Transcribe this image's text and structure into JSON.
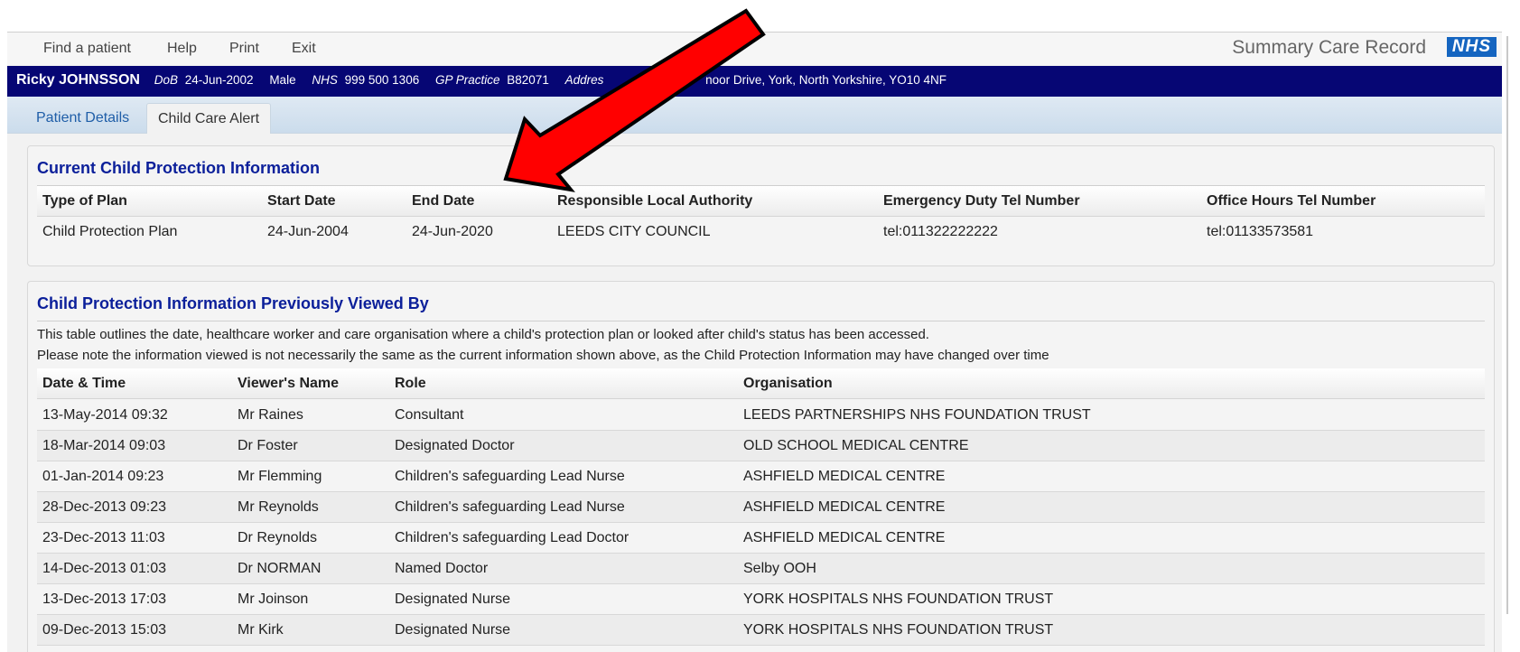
{
  "menu": {
    "items": [
      {
        "label": "Find a patient"
      },
      {
        "label": "Help"
      },
      {
        "label": "Print"
      },
      {
        "label": "Exit"
      }
    ],
    "brand": "Summary Care Record",
    "logo": "NHS"
  },
  "patient": {
    "name": "Ricky JOHNSSON",
    "dob_label": "DoB",
    "dob": "24-Jun-2002",
    "gender": "Male",
    "nhs_label": "NHS",
    "nhs": "999 500 1306",
    "gp_label": "GP Practice",
    "gp": "B82071",
    "address_label": "Addres",
    "address": "noor Drive, York, North Yorkshire, YO10 4NF"
  },
  "tabs": [
    {
      "label": "Patient Details",
      "active": false
    },
    {
      "label": "Child Care Alert",
      "active": true
    }
  ],
  "current": {
    "title": "Current Child Protection Information",
    "headers": [
      "Type of Plan",
      "Start Date",
      "End Date",
      "Responsible Local Authority",
      "Emergency Duty Tel Number",
      "Office Hours Tel Number"
    ],
    "row": [
      "Child Protection Plan",
      "24-Jun-2004",
      "24-Jun-2020",
      "LEEDS CITY COUNCIL",
      "tel:011322222222",
      "tel:01133573581"
    ]
  },
  "viewed": {
    "title": "Child Protection Information Previously Viewed By",
    "desc1": "This table outlines the date, healthcare worker and care organisation where a child's protection plan or looked after child's status has been accessed.",
    "desc2": "Please note the information viewed is not necessarily the same as the current information shown above, as the Child Protection Information may have changed over time",
    "headers": [
      "Date & Time",
      "Viewer's Name",
      "Role",
      "Organisation"
    ],
    "rows": [
      [
        "13-May-2014 09:32",
        "Mr Raines",
        "Consultant",
        "LEEDS PARTNERSHIPS NHS FOUNDATION TRUST"
      ],
      [
        "18-Mar-2014 09:03",
        "Dr Foster",
        "Designated Doctor",
        "OLD SCHOOL MEDICAL CENTRE"
      ],
      [
        "01-Jan-2014 09:23",
        "Mr Flemming",
        "Children's safeguarding Lead Nurse",
        "ASHFIELD MEDICAL CENTRE"
      ],
      [
        "28-Dec-2013 09:23",
        "Mr Reynolds",
        "Children's safeguarding Lead Nurse",
        "ASHFIELD MEDICAL CENTRE"
      ],
      [
        "23-Dec-2013 11:03",
        "Dr Reynolds",
        "Children's safeguarding Lead Doctor",
        "ASHFIELD MEDICAL CENTRE"
      ],
      [
        "14-Dec-2013 01:03",
        "Dr NORMAN",
        "Named Doctor",
        "Selby OOH"
      ],
      [
        "13-Dec-2013 17:03",
        "Mr Joinson",
        "Designated Nurse",
        "YORK HOSPITALS NHS FOUNDATION TRUST"
      ],
      [
        "09-Dec-2013 15:03",
        "Mr Kirk",
        "Designated Nurse",
        "YORK HOSPITALS NHS FOUNDATION TRUST"
      ]
    ]
  },
  "annotation": {
    "arrow_icon": "red-arrow-icon",
    "color": "#ff0000"
  }
}
